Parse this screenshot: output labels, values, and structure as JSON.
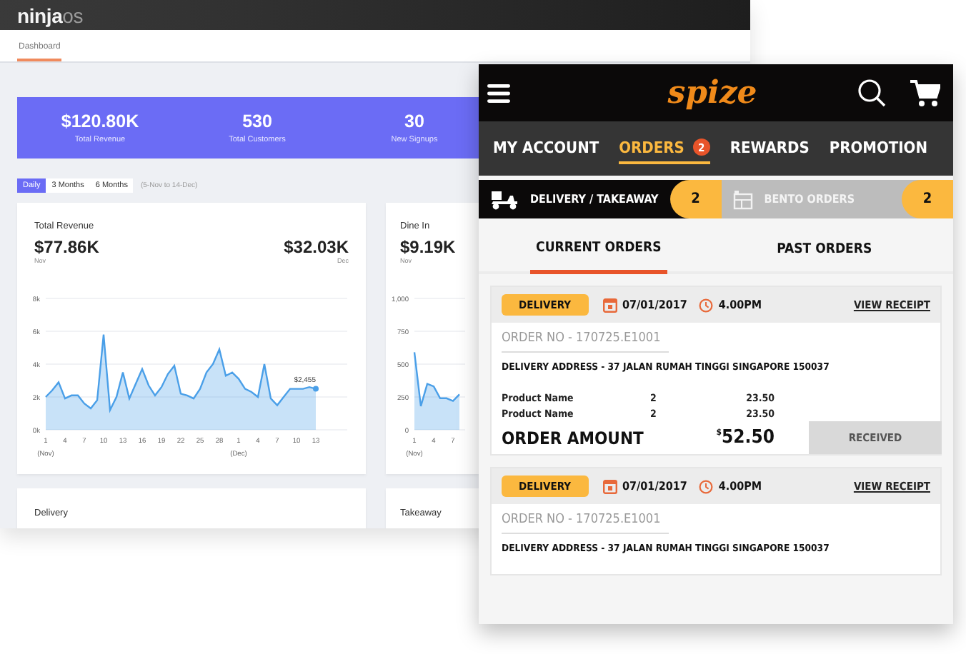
{
  "dashboard": {
    "logo": {
      "main": "ninja",
      "suffix": "os"
    },
    "tabs": [
      {
        "label": "Dashboard",
        "selected": true
      }
    ],
    "stats": [
      {
        "value": "$120.80K",
        "label": "Total Revenue"
      },
      {
        "value": "530",
        "label": "Total Customers"
      },
      {
        "value": "30",
        "label": "New Signups"
      }
    ],
    "periods": [
      {
        "label": "Daily",
        "selected": true
      },
      {
        "label": "3 Months",
        "selected": false
      },
      {
        "label": "6 Months",
        "selected": false
      }
    ],
    "range": "(5-Nov to 14-Dec)",
    "cards": [
      {
        "figures": [
          {
            "value": "$77.86K",
            "caption": "Nov"
          },
          {
            "value": "$32.03K",
            "caption": "Dec"
          }
        ],
        "axis_periods": [
          "(Nov)",
          "(Dec)"
        ],
        "chart_data": {
          "type": "area",
          "title": "Total Revenue",
          "grid": true,
          "categories": [
            "1",
            null,
            null,
            "4",
            null,
            null,
            "7",
            null,
            null,
            "10",
            null,
            null,
            "13",
            null,
            null,
            "16",
            null,
            null,
            "19",
            null,
            null,
            "22",
            null,
            null,
            "25",
            null,
            null,
            "28",
            null,
            null,
            "1",
            null,
            null,
            "4",
            null,
            null,
            "7",
            null,
            null,
            "10",
            null,
            null,
            "13"
          ],
          "series": [
            {
              "color": "#4a9fe8",
              "values": [
                2.0,
                2.4,
                2.9,
                1.9,
                2.1,
                2.1,
                1.6,
                1.3,
                1.8,
                5.8,
                1.2,
                2.0,
                3.5,
                1.9,
                2.8,
                3.7,
                2.7,
                2.1,
                2.6,
                3.4,
                3.9,
                2.2,
                2.1,
                1.9,
                2.5,
                3.5,
                4.0,
                4.9,
                3.3,
                3.5,
                3.1,
                2.5,
                2.3,
                2.0,
                4.0,
                1.9,
                1.5,
                2.0,
                2.5,
                2.5,
                2.5,
                2.6,
                2.5
              ]
            }
          ],
          "ylim": [
            0,
            8
          ],
          "yticks": [
            {
              "value": 0,
              "label": "0k"
            },
            {
              "value": 2,
              "label": "2k"
            },
            {
              "value": 4,
              "label": "4k"
            },
            {
              "value": 6,
              "label": "6k"
            },
            {
              "value": 8,
              "label": "8k"
            }
          ],
          "annotations": [
            "$2,455"
          ]
        }
      },
      {
        "figures": [
          {
            "value": "$9.19K",
            "caption": "Nov"
          }
        ],
        "axis_periods": [
          "(Nov)"
        ],
        "chart_data": {
          "type": "area",
          "title": "Dine In",
          "grid": true,
          "categories": [
            "1",
            null,
            null,
            "4",
            null,
            null,
            "7",
            null
          ],
          "series": [
            {
              "color": "#4a9fe8",
              "values": [
                590,
                180,
                350,
                330,
                240,
                240,
                220,
                270
              ]
            }
          ],
          "ylim": [
            0,
            1000
          ],
          "yticks": [
            {
              "value": 0,
              "label": "0"
            },
            {
              "value": 250,
              "label": "250"
            },
            {
              "value": 500,
              "label": "500"
            },
            {
              "value": 750,
              "label": "750"
            },
            {
              "value": 1000,
              "label": "1,000"
            }
          ]
        }
      }
    ],
    "bottom_cards": [
      {
        "title": "Delivery"
      },
      {
        "title": "Takeaway"
      }
    ]
  },
  "app": {
    "logo": "spize",
    "nav": [
      {
        "label": "MY ACCOUNT",
        "selected": false
      },
      {
        "label": "ORDERS",
        "selected": true,
        "badge": "2"
      },
      {
        "label": "REWARDS",
        "selected": false
      },
      {
        "label": "PROMOTION",
        "selected": false
      }
    ],
    "order_types": [
      {
        "kind": "delivery",
        "label": "DELIVERY / TAKEAWAY",
        "count": "2",
        "selected": true
      },
      {
        "kind": "bento",
        "label": "BENTO ORDERS",
        "count": "2",
        "selected": false
      }
    ],
    "subtabs": [
      {
        "label": "CURRENT ORDERS",
        "selected": true
      },
      {
        "label": "PAST ORDERS",
        "selected": false
      }
    ],
    "orders": [
      {
        "type": "DELIVERY",
        "date": "07/01/2017",
        "time": "4.00PM",
        "receipt": "VIEW RECEIPT",
        "order_no": "ORDER NO - 170725.E1001",
        "address": "DELIVERY ADDRESS - 37 JALAN RUMAH TINGGI SINGAPORE 150037",
        "products": [
          {
            "name": "Product Name",
            "qty": "2",
            "price": "23.50"
          },
          {
            "name": "Product Name",
            "qty": "2",
            "price": "23.50"
          }
        ],
        "amount_label": "ORDER AMOUNT",
        "currency": "$",
        "amount": "52.50",
        "status": "RECEIVED"
      },
      {
        "type": "DELIVERY",
        "date": "07/01/2017",
        "time": "4.00PM",
        "receipt": "VIEW RECEIPT",
        "order_no": "ORDER NO - 170725.E1001",
        "address": "DELIVERY ADDRESS - 37 JALAN RUMAH TINGGI SINGAPORE 150037"
      }
    ]
  }
}
